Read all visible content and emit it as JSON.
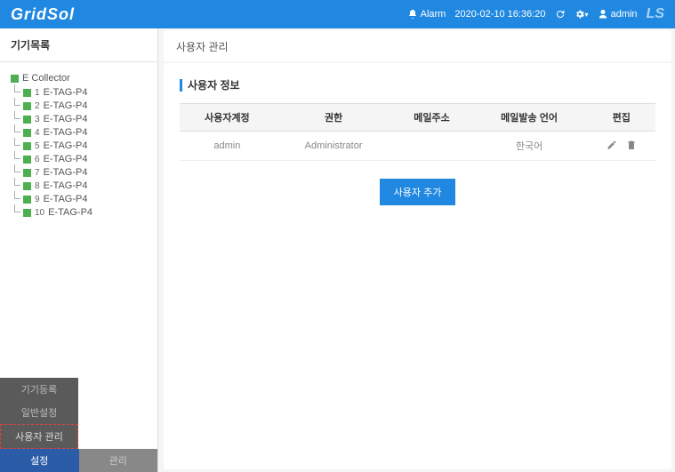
{
  "header": {
    "logo": "GridSol",
    "alarm": "Alarm",
    "datetime": "2020-02-10 16:36:20",
    "user": "admin",
    "brand": "LS"
  },
  "sidebar": {
    "title": "기기목록",
    "root": "E Collector",
    "items": [
      {
        "num": "1",
        "label": "E-TAG-P4"
      },
      {
        "num": "2",
        "label": "E-TAG-P4"
      },
      {
        "num": "3",
        "label": "E-TAG-P4"
      },
      {
        "num": "4",
        "label": "E-TAG-P4"
      },
      {
        "num": "5",
        "label": "E-TAG-P4"
      },
      {
        "num": "6",
        "label": "E-TAG-P4"
      },
      {
        "num": "7",
        "label": "E-TAG-P4"
      },
      {
        "num": "8",
        "label": "E-TAG-P4"
      },
      {
        "num": "9",
        "label": "E-TAG-P4"
      },
      {
        "num": "10",
        "label": "E-TAG-P4"
      }
    ]
  },
  "bottom_nav": {
    "item1": "기기등록",
    "item2": "일반설정",
    "item3": "사용자 관리",
    "item4": "설정",
    "item5": "관리"
  },
  "content": {
    "title": "사용자 관리",
    "section": "사용자 정보",
    "headers": {
      "account": "사용자계정",
      "role": "권한",
      "email": "메일주소",
      "lang": "메일발송 언어",
      "edit": "편집"
    },
    "rows": [
      {
        "account": "admin",
        "role": "Administrator",
        "email": "",
        "lang": "한국어"
      }
    ],
    "add_btn": "사용자 추가"
  }
}
